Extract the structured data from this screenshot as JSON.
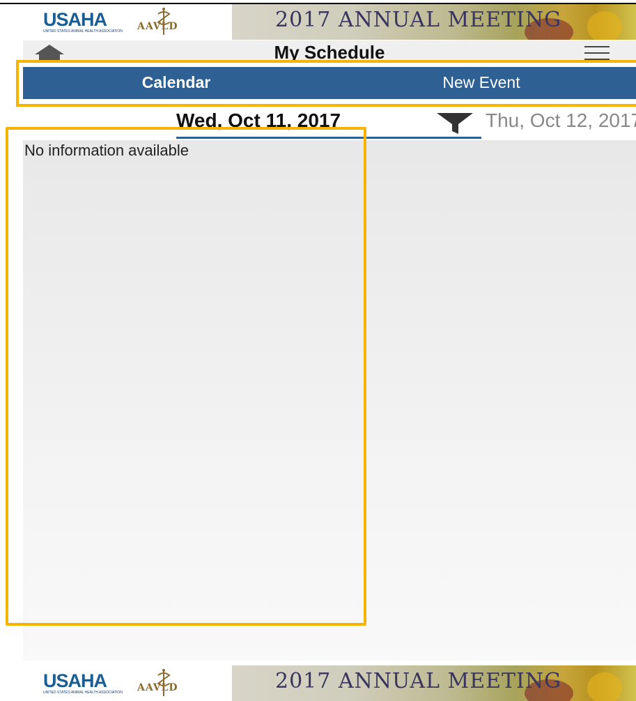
{
  "banner": {
    "usaha_logo_text": "USAHA",
    "usaha_tagline": "UNITED STATES ANIMAL HEALTH ASSOCIATION",
    "aavld_logo_text": "AAVLD",
    "meeting_title": "2017 ANNUAL MEETING"
  },
  "header": {
    "title": "My Schedule"
  },
  "tabs": [
    {
      "label": "Calendar"
    },
    {
      "label": "New Event"
    }
  ],
  "dates": {
    "active": "Wed, Oct 11, 2017",
    "next": "Thu, Oct 12, 2017"
  },
  "content": {
    "empty_message": "No information available"
  },
  "colors": {
    "accent": "#2e6094",
    "highlight": "#f6b400"
  },
  "icons": {
    "home": "home-icon",
    "menu": "hamburger-menu-icon",
    "filter": "filter-icon"
  }
}
